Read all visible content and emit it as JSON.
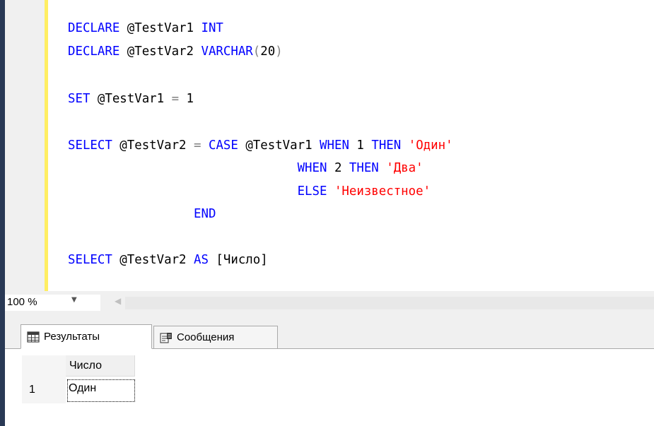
{
  "editor": {
    "lines": [
      [
        {
          "t": "DECLARE",
          "c": "kw"
        },
        {
          "t": " @TestVar1 ",
          "c": "txt"
        },
        {
          "t": "INT",
          "c": "kw"
        }
      ],
      [
        {
          "t": "DECLARE",
          "c": "kw"
        },
        {
          "t": " @TestVar2 ",
          "c": "txt"
        },
        {
          "t": "VARCHAR",
          "c": "kw"
        },
        {
          "t": "(",
          "c": "op"
        },
        {
          "t": "20",
          "c": "txt"
        },
        {
          "t": ")",
          "c": "op"
        }
      ],
      [],
      [
        {
          "t": "SET",
          "c": "kw"
        },
        {
          "t": " @TestVar1 ",
          "c": "txt"
        },
        {
          "t": "=",
          "c": "op"
        },
        {
          "t": " 1",
          "c": "txt"
        }
      ],
      [],
      [
        {
          "t": "SELECT",
          "c": "kw"
        },
        {
          "t": " @TestVar2 ",
          "c": "txt"
        },
        {
          "t": "=",
          "c": "op"
        },
        {
          "t": " ",
          "c": "txt"
        },
        {
          "t": "CASE",
          "c": "kw"
        },
        {
          "t": " @TestVar1 ",
          "c": "txt"
        },
        {
          "t": "WHEN",
          "c": "kw"
        },
        {
          "t": " 1 ",
          "c": "txt"
        },
        {
          "t": "THEN",
          "c": "kw"
        },
        {
          "t": " ",
          "c": "txt"
        },
        {
          "t": "'Один'",
          "c": "str"
        }
      ],
      [
        {
          "t": "                               ",
          "c": "txt"
        },
        {
          "t": "WHEN",
          "c": "kw"
        },
        {
          "t": " 2 ",
          "c": "txt"
        },
        {
          "t": "THEN",
          "c": "kw"
        },
        {
          "t": " ",
          "c": "txt"
        },
        {
          "t": "'Два'",
          "c": "str"
        }
      ],
      [
        {
          "t": "                               ",
          "c": "txt"
        },
        {
          "t": "ELSE",
          "c": "kw"
        },
        {
          "t": " ",
          "c": "txt"
        },
        {
          "t": "'Неизвестное'",
          "c": "str"
        }
      ],
      [
        {
          "t": "                 ",
          "c": "txt"
        },
        {
          "t": "END",
          "c": "kw"
        }
      ],
      [],
      [
        {
          "t": "SELECT",
          "c": "kw"
        },
        {
          "t": " @TestVar2 ",
          "c": "txt"
        },
        {
          "t": "AS",
          "c": "kw"
        },
        {
          "t": " [Число]",
          "c": "txt"
        }
      ]
    ]
  },
  "zoom": {
    "value": "100 %",
    "arrow": "▼",
    "scroll_left": "◀"
  },
  "tabs": {
    "results": "Результаты",
    "messages": "Сообщения"
  },
  "grid": {
    "header": "Число",
    "rows": [
      {
        "num": "1",
        "value": "Один"
      }
    ]
  },
  "colors": {
    "keyword": "#0000ff",
    "string": "#ff0000",
    "operator": "#808080",
    "change_bar": "#ffee62",
    "left_strip": "#293955"
  }
}
